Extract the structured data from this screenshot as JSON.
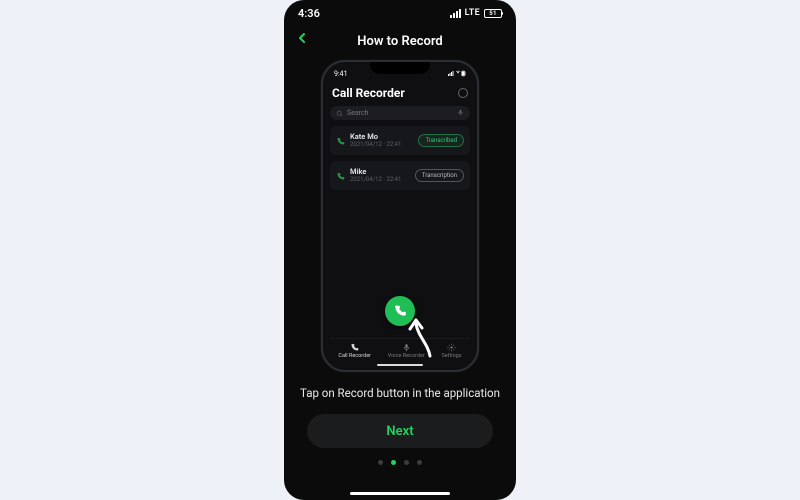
{
  "status": {
    "time": "4:36",
    "network": "LTE",
    "battery": "51"
  },
  "nav": {
    "title": "How to Record"
  },
  "inner": {
    "status_time": "9:41",
    "title": "Call Recorder",
    "search_placeholder": "Search",
    "rows": [
      {
        "name": "Kate Mo",
        "date": "2021/04/12 · 22:41",
        "badge": "Transcribed"
      },
      {
        "name": "Mike",
        "date": "2021/04/12 · 22:41",
        "badge": "Transcription"
      }
    ],
    "tabs": [
      "Call Recorder",
      "Voice Recorder",
      "Settings"
    ]
  },
  "instruction": "Tap on Record button in the application",
  "cta": "Next",
  "page_dots": {
    "count": 4,
    "active_index": 1
  }
}
